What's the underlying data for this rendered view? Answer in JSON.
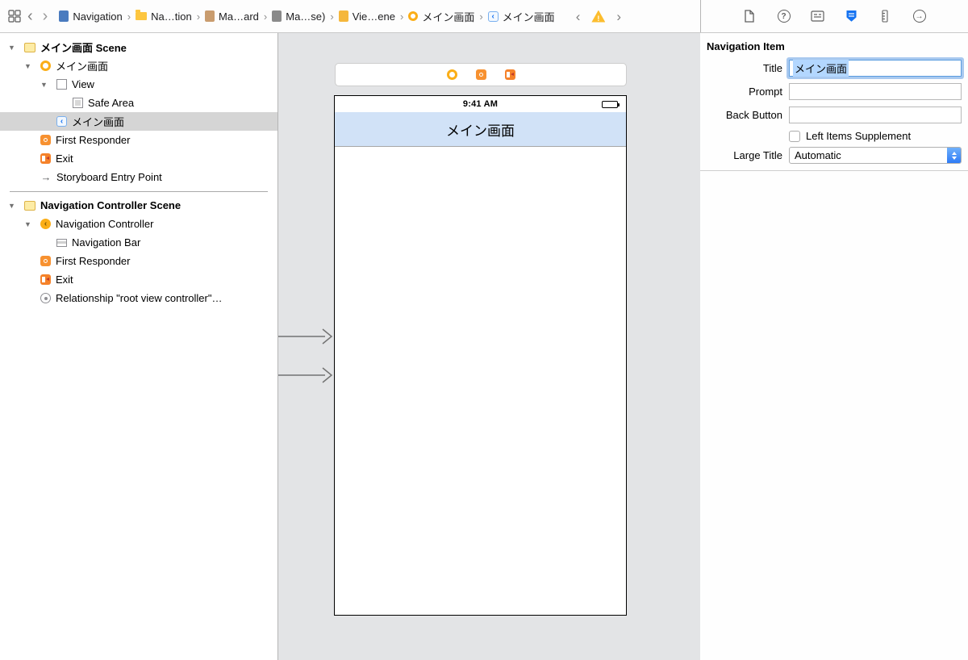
{
  "jump_bar": {
    "items": [
      {
        "label": "Navigation",
        "icon": "project-file-icon"
      },
      {
        "label": "Na…tion",
        "icon": "folder-icon"
      },
      {
        "label": "Ma…ard",
        "icon": "storyboard-file-icon"
      },
      {
        "label": "Ma…se)",
        "icon": "base-file-icon"
      },
      {
        "label": "Vie…ene",
        "icon": "scene-doc-icon"
      },
      {
        "label": "メイン画面",
        "icon": "view-controller-icon"
      },
      {
        "label": "メイン画面",
        "icon": "navigation-item-icon"
      }
    ],
    "warning_mark": "!"
  },
  "outline": {
    "rows": [
      {
        "label": "メイン画面 Scene"
      },
      {
        "label": "メイン画面"
      },
      {
        "label": "View"
      },
      {
        "label": "Safe Area"
      },
      {
        "label": "メイン画面"
      },
      {
        "label": "First Responder"
      },
      {
        "label": "Exit"
      },
      {
        "label": "Storyboard Entry Point"
      },
      {
        "label": "Navigation Controller Scene"
      },
      {
        "label": "Navigation Controller"
      },
      {
        "label": "Navigation Bar"
      },
      {
        "label": "First Responder"
      },
      {
        "label": "Exit"
      },
      {
        "label": "Relationship \"root view controller\"…"
      }
    ]
  },
  "canvas": {
    "status_time": "9:41 AM",
    "nav_title": "メイン画面"
  },
  "inspector": {
    "header": "Navigation Item",
    "title_label": "Title",
    "title_value": "メイン画面",
    "prompt_label": "Prompt",
    "prompt_value": "",
    "back_button_label": "Back Button",
    "back_button_value": "",
    "left_items_label": "Left Items Supplement",
    "large_title_label": "Large Title",
    "large_title_value": "Automatic",
    "nc_glyph": "‹",
    "ni_glyph": "‹"
  },
  "colors": {
    "accent_blue": "#1673f1",
    "warning_yellow": "#fcbd2e",
    "canvas_nav_bar": "#d1e2f7",
    "text_selection": "#b3d7ff",
    "vc_yellow": "#fbae17",
    "responder_orange": "#f79130"
  }
}
